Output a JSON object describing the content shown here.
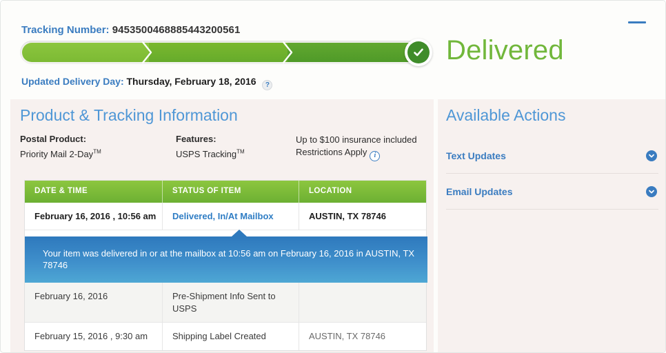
{
  "header": {
    "tracking_label": "Tracking Number:",
    "tracking_number": "9453500468885443200561",
    "status_text": "Delivered",
    "delivery_day_label": "Updated Delivery Day:",
    "delivery_day_value": "Thursday, February 18, 2016",
    "help_icon": "?",
    "minimize_icon": "minimize-bar"
  },
  "product_panel": {
    "title": "Product & Tracking Information",
    "postal_product_label": "Postal Product:",
    "postal_product_value": "Priority Mail 2-Day",
    "postal_product_sup": "TM",
    "features_label": "Features:",
    "features_value": "USPS Tracking",
    "features_sup": "TM",
    "insurance_line1": "Up to $100 insurance included",
    "insurance_line2": "Restrictions Apply",
    "info_icon": "i"
  },
  "tracking_table": {
    "columns": [
      "DATE & TIME",
      "STATUS OF ITEM",
      "LOCATION"
    ],
    "rows": [
      {
        "date": "February 16, 2016 , 10:56 am",
        "status": "Delivered, In/At Mailbox",
        "location": "AUSTIN, TX 78746"
      },
      {
        "date": "February 16, 2016",
        "status": "Pre-Shipment Info Sent to USPS",
        "location": ""
      },
      {
        "date": "February 15, 2016 , 9:30 am",
        "status": "Shipping Label Created",
        "location": "AUSTIN, TX 78746"
      }
    ],
    "tooltip": "Your item was delivered in or at the mailbox at 10:56 am on February 16, 2016 in AUSTIN, TX 78746"
  },
  "actions_panel": {
    "title": "Available Actions",
    "items": [
      {
        "label": "Text Updates"
      },
      {
        "label": "Email Updates"
      }
    ]
  },
  "colors": {
    "accent_blue": "#3a7cc0",
    "title_blue": "#4f97d6",
    "delivered_green": "#71b73b",
    "bar_green_light": "#8cc63e",
    "bar_green_dark": "#4f9a28",
    "panel_beige": "#f7f1ef",
    "tooltip_blue_top": "#2e79bd",
    "tooltip_blue_bottom": "#4ea7d4",
    "header_green": "#8dc63f"
  }
}
